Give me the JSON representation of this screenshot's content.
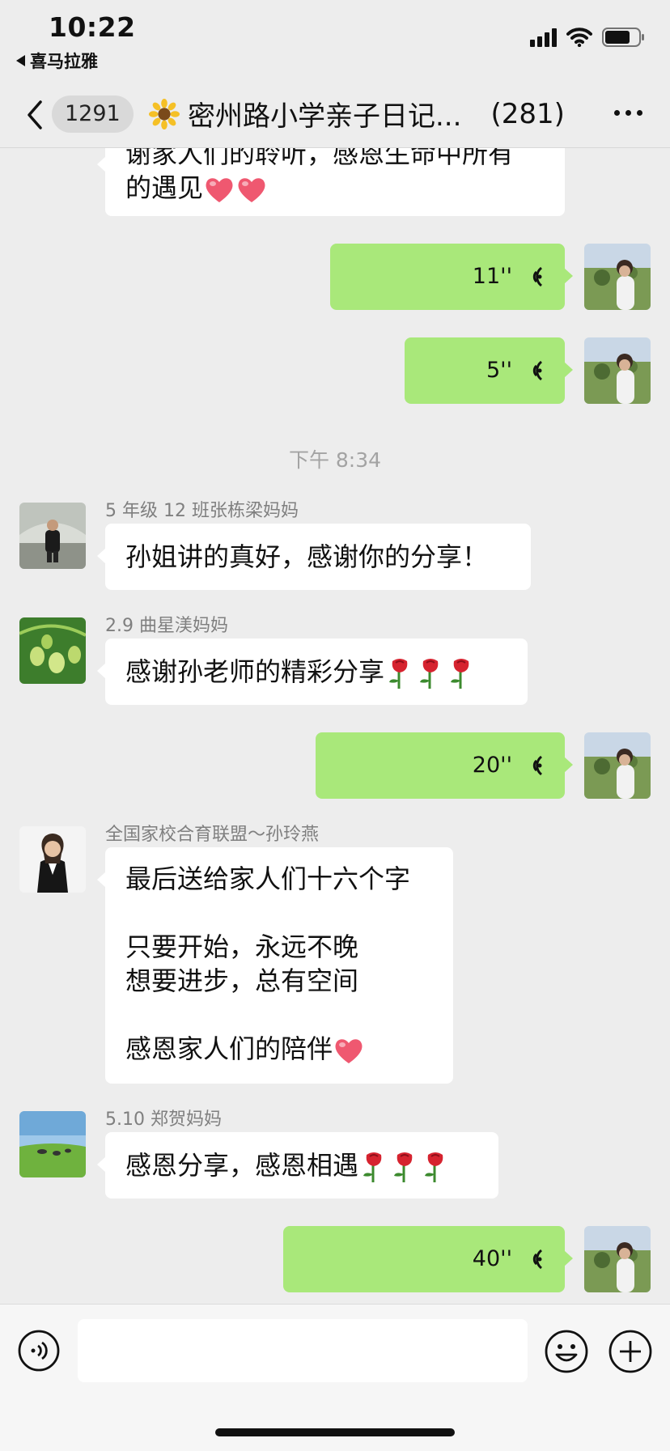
{
  "status_bar": {
    "time": "10:22",
    "back_app": "喜马拉雅"
  },
  "header": {
    "unread_badge": "1291",
    "title": "密州路小学亲子日记...",
    "member_count": "(281)"
  },
  "messages": [
    {
      "type": "text",
      "side": "left",
      "lines": [
        "谢家人们的聆听，感恩生命中所有",
        "的遇见"
      ],
      "emoji": [
        "heart",
        "heart"
      ]
    },
    {
      "type": "voice",
      "side": "right",
      "duration": "11''"
    },
    {
      "type": "voice",
      "side": "right",
      "duration": "5''"
    },
    {
      "type": "time",
      "text": "下午 8:34"
    },
    {
      "type": "text",
      "side": "left",
      "sender": "5 年级 12 班张栋梁妈妈",
      "lines": [
        "孙姐讲的真好，感谢你的分享！"
      ]
    },
    {
      "type": "text",
      "side": "left",
      "sender": "2.9 曲星渼妈妈",
      "lines": [
        "感谢孙老师的精彩分享"
      ],
      "emoji": [
        "rose",
        "rose",
        "rose"
      ]
    },
    {
      "type": "voice",
      "side": "right",
      "duration": "20''"
    },
    {
      "type": "text",
      "side": "left",
      "sender": "全国家校合育联盟～孙玲燕",
      "lines": [
        "最后送给家人们十六个字",
        "",
        "只要开始，永远不晚",
        "想要进步，总有空间",
        "",
        "感恩家人们的陪伴"
      ],
      "emoji": [
        "heart"
      ]
    },
    {
      "type": "text",
      "side": "left",
      "sender": "5.10 郑贺妈妈",
      "lines": [
        "感恩分享，感恩相遇"
      ],
      "emoji": [
        "rose",
        "rose",
        "rose"
      ]
    },
    {
      "type": "voice",
      "side": "right",
      "duration": "40''"
    }
  ],
  "input_bar": {
    "placeholder": ""
  },
  "colors": {
    "background": "#ededed",
    "sent_bubble": "#a9e87a",
    "received_bubble": "#ffffff"
  }
}
